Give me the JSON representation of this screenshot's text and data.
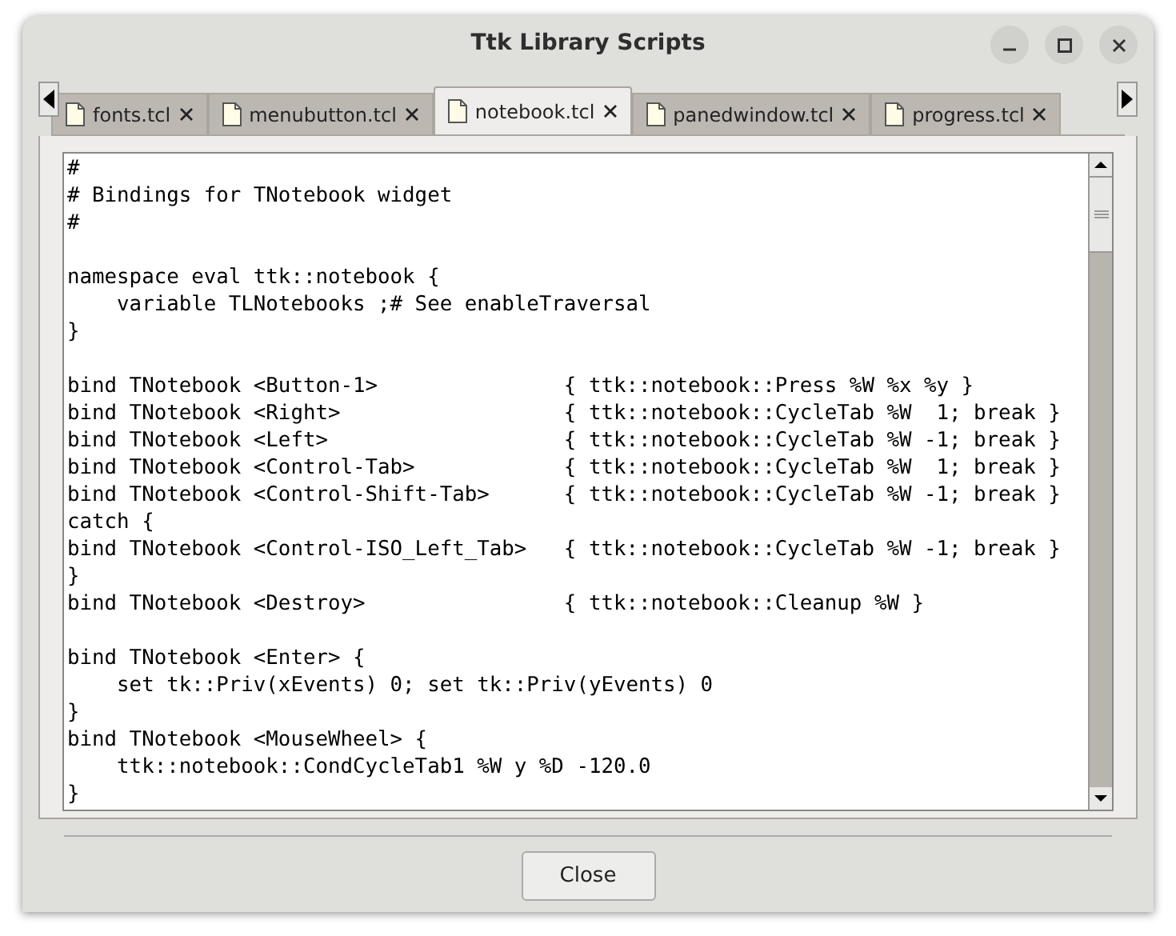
{
  "window": {
    "title": "Ttk Library Scripts"
  },
  "tabs": [
    {
      "label": "fonts.tcl",
      "selected": false
    },
    {
      "label": "menubutton.tcl",
      "selected": false
    },
    {
      "label": "notebook.tcl",
      "selected": true
    },
    {
      "label": "panedwindow.tcl",
      "selected": false
    },
    {
      "label": "progress.tcl",
      "selected": false
    }
  ],
  "code": "#\n# Bindings for TNotebook widget\n#\n\nnamespace eval ttk::notebook {\n    variable TLNotebooks ;# See enableTraversal\n}\n\nbind TNotebook <Button-1>               { ttk::notebook::Press %W %x %y }\nbind TNotebook <Right>                  { ttk::notebook::CycleTab %W  1; break }\nbind TNotebook <Left>                   { ttk::notebook::CycleTab %W -1; break }\nbind TNotebook <Control-Tab>            { ttk::notebook::CycleTab %W  1; break }\nbind TNotebook <Control-Shift-Tab>      { ttk::notebook::CycleTab %W -1; break }\ncatch {\nbind TNotebook <Control-ISO_Left_Tab>   { ttk::notebook::CycleTab %W -1; break }\n}\nbind TNotebook <Destroy>                { ttk::notebook::Cleanup %W }\n\nbind TNotebook <Enter> {\n    set tk::Priv(xEvents) 0; set tk::Priv(yEvents) 0\n}\nbind TNotebook <MouseWheel> {\n    ttk::notebook::CondCycleTab1 %W y %D -120.0\n}",
  "buttons": [
    {
      "label": "Close"
    }
  ]
}
